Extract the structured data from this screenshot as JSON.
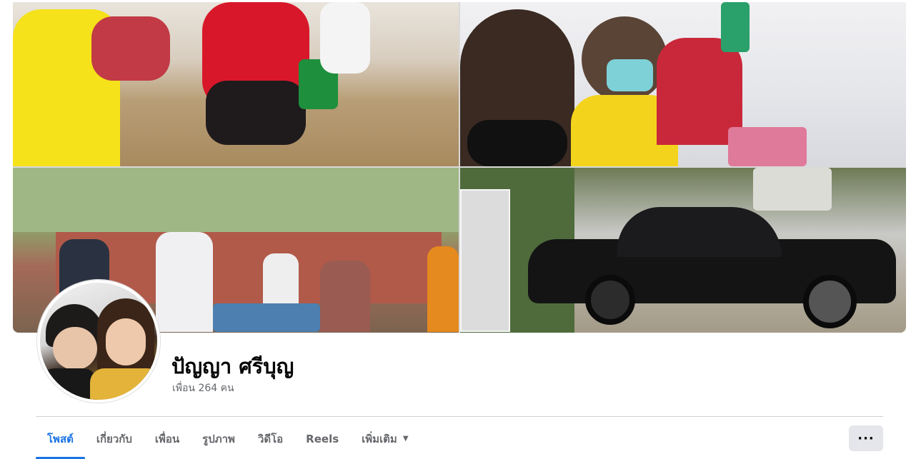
{
  "profile": {
    "name": "ปัญญา ศรีบุญ",
    "friends_text": "เพื่อน 264 คน"
  },
  "tabs": [
    {
      "label": "โพสต์",
      "active": true
    },
    {
      "label": "เกี่ยวกับ",
      "active": false
    },
    {
      "label": "เพื่อน",
      "active": false
    },
    {
      "label": "รูปภาพ",
      "active": false
    },
    {
      "label": "วิดีโอ",
      "active": false
    },
    {
      "label": "Reels",
      "active": false
    },
    {
      "label": "เพิ่มเติม",
      "active": false
    }
  ],
  "more_menu": {
    "caret": "▼"
  },
  "overflow_button": {
    "label": "···"
  },
  "colors": {
    "accent": "#1b74e4",
    "secondary_text": "#65676b",
    "button_bg": "#e4e6eb"
  },
  "icons": {
    "dropdown": "caret-down-icon",
    "overflow": "more-horizontal-icon"
  }
}
